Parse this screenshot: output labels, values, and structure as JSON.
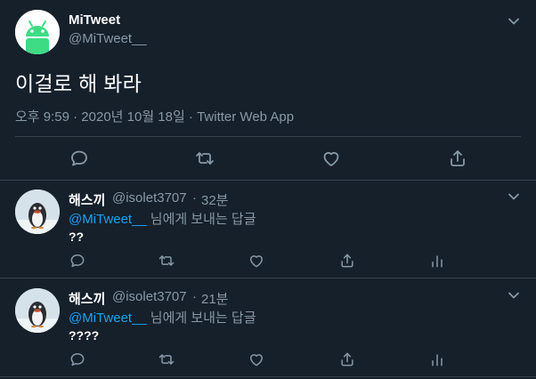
{
  "colors": {
    "background": "#15202b",
    "divider": "#38444d",
    "secondary_text": "#8899a6",
    "link": "#1da1f2",
    "android_green": "#3ddc84"
  },
  "main_tweet": {
    "author_name": "MiTweet",
    "author_handle": "@MiTweet__",
    "text": "이걸로 해 봐라",
    "meta": "오후 9:59 · 2020년 10월 18일 · Twitter Web App",
    "avatar_icon": "android-robot-icon",
    "actions": [
      "reply-icon",
      "retweet-icon",
      "like-icon",
      "share-icon"
    ]
  },
  "replies": [
    {
      "author_name": "해스끼",
      "author_handle": "@isolet3707",
      "separator": "·",
      "time": "32분",
      "reply_to_mention": "@MiTweet__",
      "reply_to_suffix": "님에게 보내는 답글",
      "text": "??",
      "avatar_icon": "pingu-penguin-icon"
    },
    {
      "author_name": "해스끼",
      "author_handle": "@isolet3707",
      "separator": "·",
      "time": "21분",
      "reply_to_mention": "@MiTweet__",
      "reply_to_suffix": "님에게 보내는 답글",
      "text": "????",
      "avatar_icon": "pingu-penguin-icon"
    }
  ]
}
